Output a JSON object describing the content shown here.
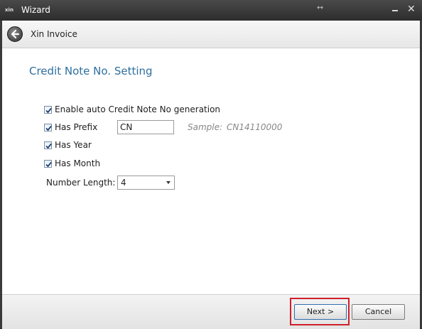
{
  "window": {
    "title": "Wizard",
    "logo_text": "xin"
  },
  "header": {
    "title": "Xin Invoice"
  },
  "section": {
    "title": "Credit Note No. Setting"
  },
  "options": {
    "auto_generation": {
      "label": "Enable auto Credit Note No generation",
      "checked": true
    },
    "has_prefix": {
      "label": "Has Prefix",
      "checked": true,
      "value": "CN"
    },
    "has_year": {
      "label": "Has Year",
      "checked": true
    },
    "has_month": {
      "label": "Has Month",
      "checked": true
    }
  },
  "sample": {
    "label": "Sample:",
    "value": "CN14110000"
  },
  "number_length": {
    "label": "Number Length:",
    "selected": "4"
  },
  "footer": {
    "next_label": "Next >",
    "cancel_label": "Cancel"
  },
  "colors": {
    "section_title": "#2e6f9e",
    "highlight_border": "#d01f2a",
    "title_bar": "#3a3a3a"
  }
}
